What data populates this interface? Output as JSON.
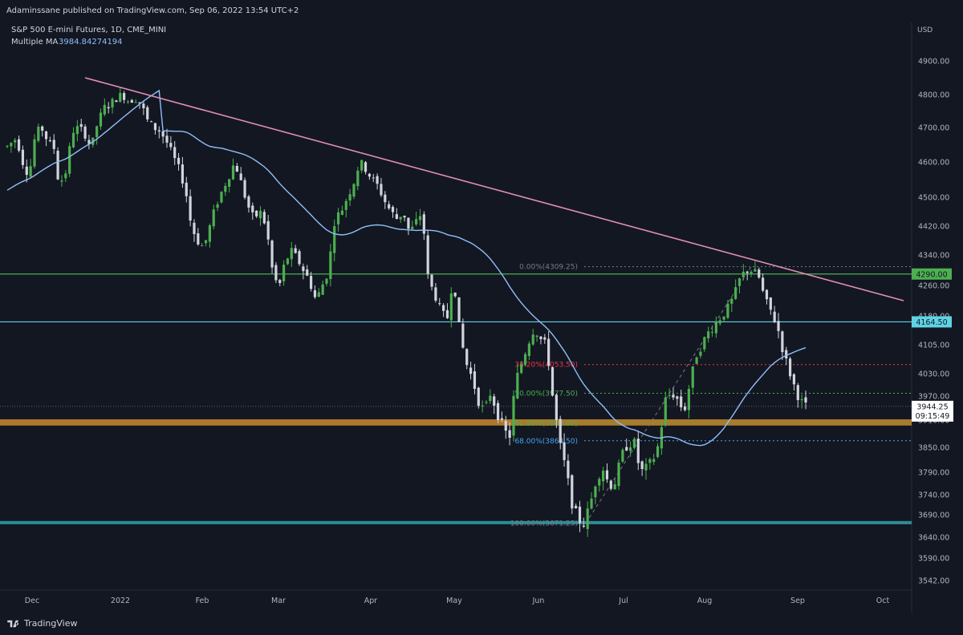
{
  "header": {
    "published": "Adaminssane published on TradingView.com, Sep 06, 2022 13:54 UTC+2"
  },
  "footer": {
    "brand": "TradingView"
  },
  "chart_data": {
    "type": "candlestick",
    "symbol_line": "S&P 500 E-mini Futures, 1D, CME_MINI",
    "indicator_label": "Multiple MA",
    "indicator_value": "3984.84274194",
    "currency": "USD",
    "y_ticks": [
      "4900.00",
      "4800.00",
      "4700.00",
      "4600.00",
      "4500.00",
      "4420.00",
      "4340.00",
      "4260.00",
      "4180.00",
      "4105.00",
      "4030.00",
      "3970.00",
      "3910.00",
      "3850.00",
      "3790.00",
      "3740.00",
      "3690.00",
      "3640.00",
      "3590.00",
      "3542.00"
    ],
    "x_ticks": [
      "Dec",
      "2022",
      "Feb",
      "Mar",
      "Apr",
      "May",
      "Jun",
      "Jul",
      "Aug",
      "Sep",
      "Oct"
    ],
    "colors": {
      "up": "#4caf50",
      "down": "#d1d4dc",
      "ma": "#90bff9",
      "trendline": "#e38fb5",
      "hline_green": "#4caf50",
      "hline_cyan": "#5fd3e5",
      "zone_orange": "#c98a2b",
      "zone_teal": "#2aa3ad",
      "fib_red": "#f23645",
      "fib_green": "#4caf50",
      "fib_blue": "#42a5f5",
      "fib_gray": "#787b86"
    },
    "horizontal_lines": [
      {
        "price": 4290.0,
        "label": "4290.00",
        "color": "#4caf50"
      },
      {
        "price": 4164.5,
        "label": "4164.50",
        "color": "#5fd3e5"
      }
    ],
    "current_price": {
      "label": "3944.25",
      "countdown": "09:15:49"
    },
    "zones": [
      {
        "from": 3898,
        "to": 3912,
        "color": "#c98a2b"
      },
      {
        "from": 3670,
        "to": 3676,
        "color": "#2aa3ad"
      }
    ],
    "fibonacci": [
      {
        "label": "0.00%(4309.25)",
        "price": 4309.25,
        "color": "#787b86"
      },
      {
        "label": "38.20%(4053.50)",
        "price": 4053.5,
        "color": "#f23645"
      },
      {
        "label": "50.00%(3977.50)",
        "price": 3977.5,
        "color": "#4caf50"
      },
      {
        "label": "61.80%(3903.00)",
        "price": 3903.0,
        "color": "#4caf50"
      },
      {
        "label": "68.00%(3864.50)",
        "price": 3864.5,
        "color": "#42a5f5"
      },
      {
        "label": "100.00%(3671.25)",
        "price": 3671.25,
        "color": "#787b86"
      }
    ],
    "trendline": {
      "from_price": 4850,
      "to_price": 4220
    }
  }
}
